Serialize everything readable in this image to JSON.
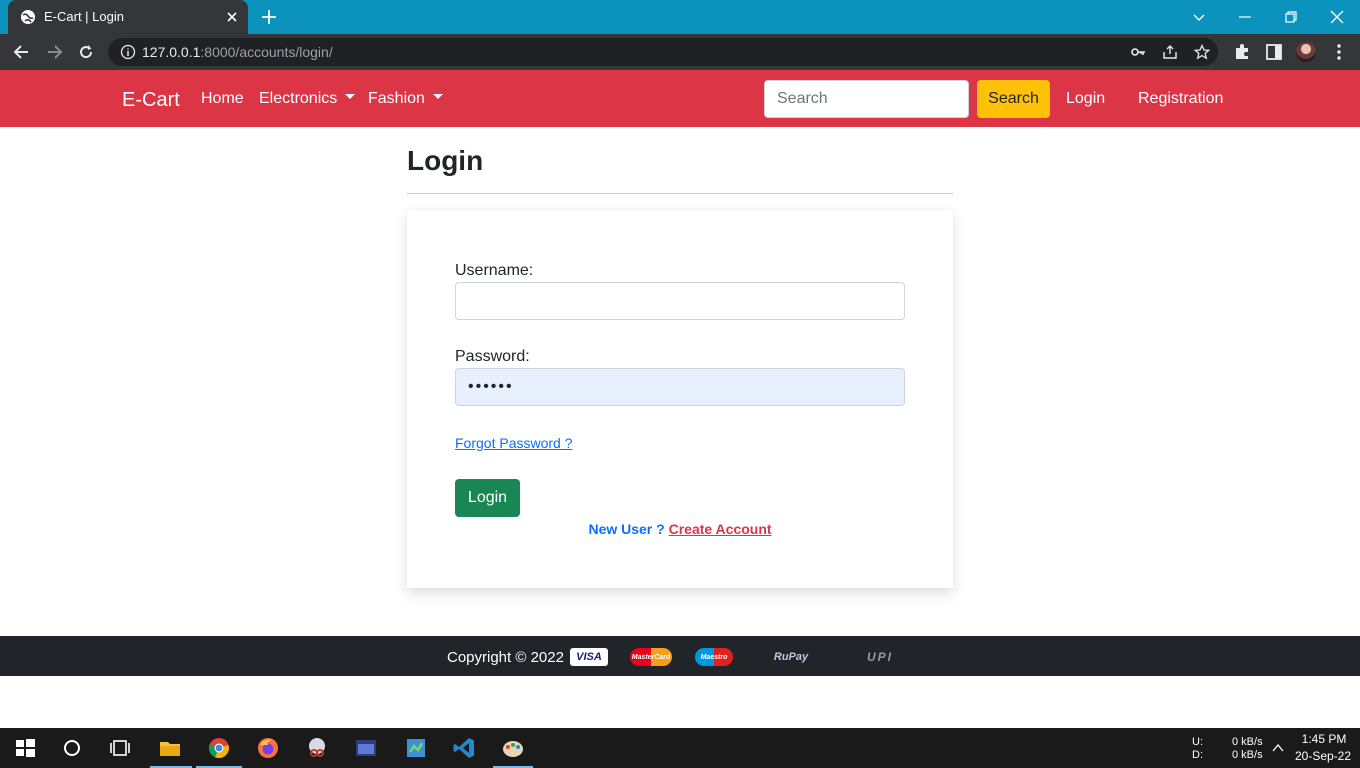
{
  "browser": {
    "tab_title": "E-Cart | Login",
    "url_host": "127.0.0.1",
    "url_rest": ":8000/accounts/login/"
  },
  "nav": {
    "brand": "E-Cart",
    "home": "Home",
    "electronics": "Electronics",
    "fashion": "Fashion",
    "search_placeholder": "Search",
    "search_button": "Search",
    "login": "Login",
    "registration": "Registration"
  },
  "main": {
    "title": "Login",
    "username_label": "Username:",
    "username_value": "",
    "password_label": "Password:",
    "password_value": "••••••",
    "forgot": "Forgot Password ?",
    "login_button": "Login",
    "new_user": "New User ?",
    "create_account": "Create Account"
  },
  "footer": {
    "copyright": "Copyright © 2022",
    "payment_logos": [
      "VISA",
      "MasterCard",
      "Maestro",
      "RuPay",
      "UPI"
    ]
  },
  "taskbar": {
    "net_up_label": "U:",
    "net_down_label": "D:",
    "net_up": "0 kB/s",
    "net_down": "0 kB/s",
    "time": "1:45 PM",
    "date": "20-Sep-22"
  },
  "colors": {
    "navbar": "#dc3545",
    "search_button": "#ffc107",
    "login_button": "#198754",
    "footer": "#212529",
    "tabstrip": "#0b93bd"
  }
}
